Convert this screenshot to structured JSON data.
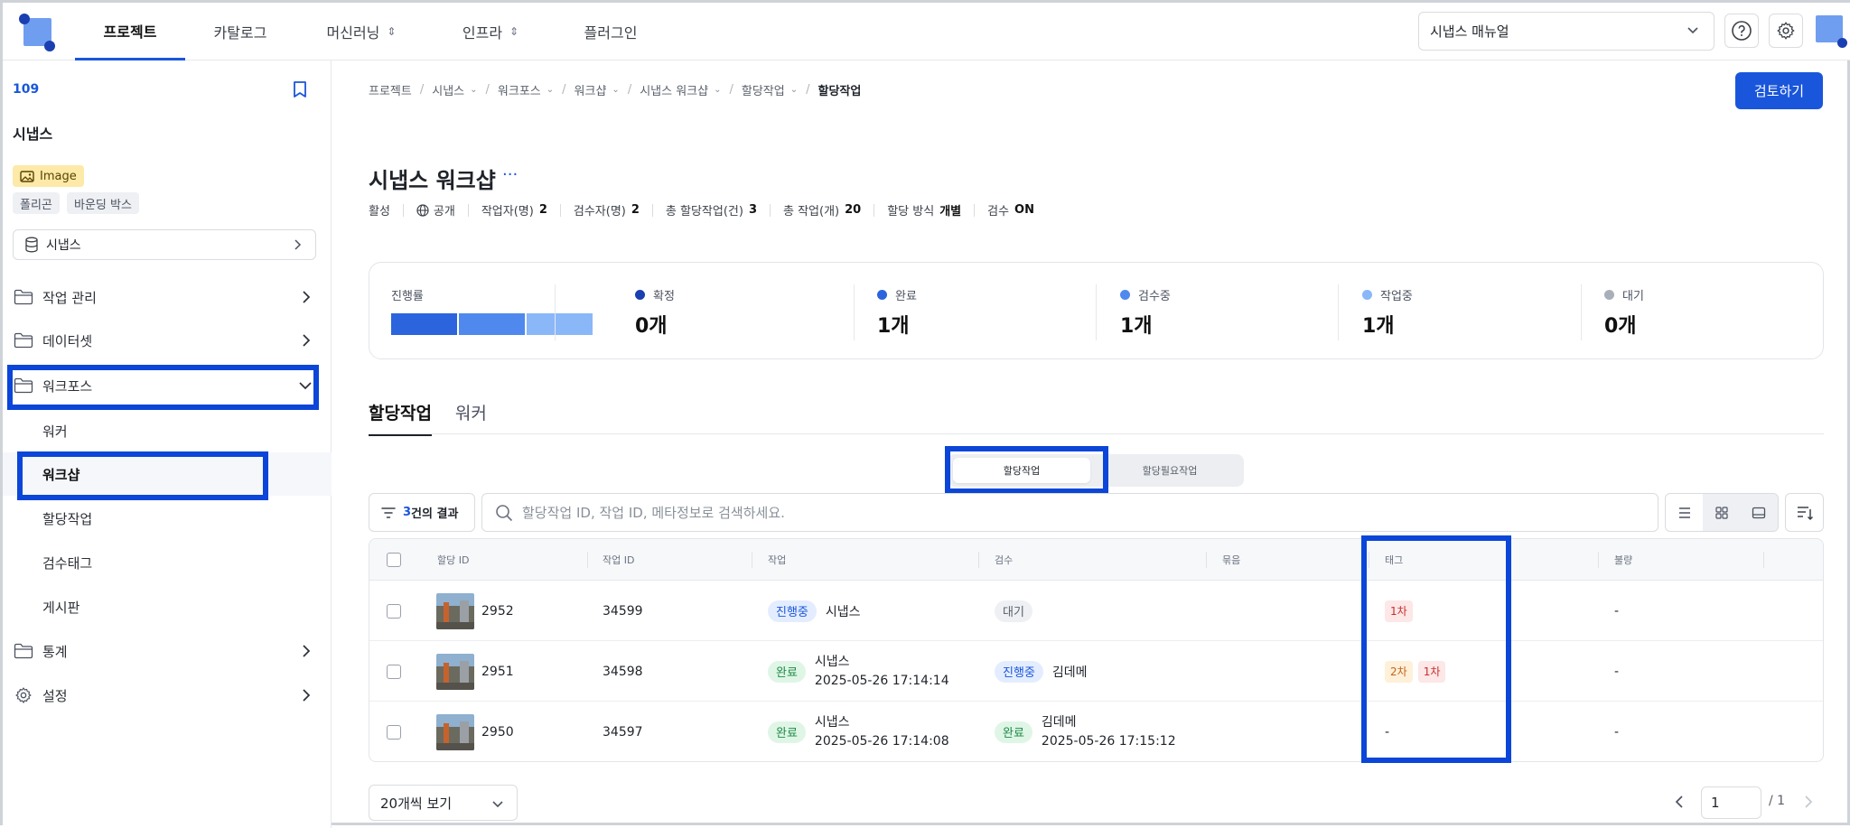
{
  "topnav": {
    "items": [
      {
        "label": "프로젝트",
        "active": true
      },
      {
        "label": "카탈로그"
      },
      {
        "label": "머신러닝",
        "chevron": "⌃⌄"
      },
      {
        "label": "인프라",
        "chevron": "⌃⌄"
      },
      {
        "label": "플러그인"
      }
    ],
    "manual_select": "시냅스 매뉴얼"
  },
  "sidebar": {
    "project_id": "109",
    "project_name": "시냅스",
    "data_type": "Image",
    "tags": [
      "폴리곤",
      "바운딩 박스"
    ],
    "dataset_select": "시냅스",
    "menu": {
      "task_manage": "작업 관리",
      "dataset": "데이터셋",
      "workforce": "워크포스",
      "worker": "워커",
      "workshop": "워크샵",
      "assignment": "할당작업",
      "review_tag": "검수태그",
      "board": "게시판",
      "stats": "통계",
      "settings": "설정"
    }
  },
  "breadcrumb": [
    "프로젝트",
    "시냅스",
    "워크포스",
    "워크샵",
    "시냅스 워크샵",
    "할당작업",
    "할당작업"
  ],
  "review_button": "검토하기",
  "page": {
    "title": "시냅스 워크샵",
    "more": "···",
    "meta": {
      "status": "활성",
      "visibility": "공개",
      "workers_label": "작업자(명)",
      "workers": "2",
      "reviewers_label": "검수자(명)",
      "reviewers": "2",
      "total_assign_label": "총 할당작업(건)",
      "total_assign": "3",
      "total_tasks_label": "총 작업(개)",
      "total_tasks": "20",
      "method_label": "할당 방식",
      "method": "개별",
      "review_label": "검수",
      "review": "ON"
    }
  },
  "stats": {
    "progress_label": "진행률",
    "progress_segments": [
      {
        "fraction": 0.333,
        "color": "#2b64dd"
      },
      {
        "fraction": 0.333,
        "color": "#4f89ee"
      },
      {
        "fraction": 0.334,
        "color": "#8ab7f8"
      }
    ],
    "items": [
      {
        "label": "확정",
        "value": "0개",
        "color": "#1a3fb0"
      },
      {
        "label": "완료",
        "value": "1개",
        "color": "#2b64dd"
      },
      {
        "label": "검수중",
        "value": "1개",
        "color": "#4f89ee"
      },
      {
        "label": "작업중",
        "value": "1개",
        "color": "#8ab7f8"
      },
      {
        "label": "대기",
        "value": "0개",
        "color": "#a9afb8"
      }
    ]
  },
  "tabs": [
    "할당작업",
    "워커"
  ],
  "segment": [
    "할당작업",
    "할당필요작업"
  ],
  "toolbar": {
    "result_count": "3",
    "result_suffix": "건의 결과",
    "search_placeholder": "할당작업 ID, 작업 ID, 메타정보로 검색하세요."
  },
  "table": {
    "columns": [
      "할당 ID",
      "작업 ID",
      "작업",
      "검수",
      "묶음",
      "태그",
      "불량"
    ],
    "rows": [
      {
        "assign_id": "2952",
        "task_id": "34599",
        "work_status": "진행중",
        "work_name": "시냅스",
        "work_time": "",
        "review_status": "대기",
        "review_name": "",
        "review_time": "",
        "tags": [
          "1차"
        ],
        "defect": "-"
      },
      {
        "assign_id": "2951",
        "task_id": "34598",
        "work_status": "완료",
        "work_name": "시냅스",
        "work_time": "2025-05-26 17:14:14",
        "review_status": "진행중",
        "review_name": "김데메",
        "review_time": "",
        "tags": [
          "2차",
          "1차"
        ],
        "defect": "-"
      },
      {
        "assign_id": "2950",
        "task_id": "34597",
        "work_status": "완료",
        "work_name": "시냅스",
        "work_time": "2025-05-26 17:14:08",
        "review_status": "완료",
        "review_name": "김데메",
        "review_time": "2025-05-26 17:15:12",
        "tags": [],
        "tag_empty": "-",
        "defect": "-"
      }
    ]
  },
  "pagination": {
    "per_page": "20개씩 보기",
    "current": "1",
    "total": "/ 1"
  }
}
